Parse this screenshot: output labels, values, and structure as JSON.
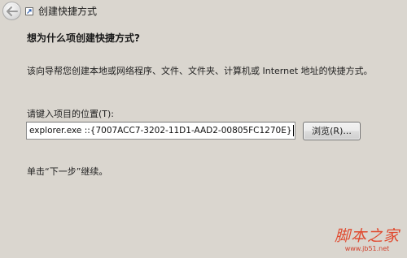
{
  "header": {
    "title": "创建快捷方式",
    "back_icon": "back-arrow-icon",
    "window_icon": "shortcut-icon"
  },
  "main": {
    "heading": "想为什么项创建快捷方式?",
    "description": "该向导帮您创建本地或网络程序、文件、文件夹、计算机或 Internet 地址的快捷方式。",
    "location_label": "请键入项目的位置(T):",
    "location_value": "explorer.exe ::{7007ACC7-3202-11D1-AAD2-00805FC1270E}",
    "browse_label": "浏览(R)...",
    "hint": "单击“下一步”继续。"
  },
  "watermark": {
    "title": "脚本之家",
    "url": "www.jb51.net"
  },
  "colors": {
    "background": "#dad6cf",
    "input_background": "#ffffff",
    "watermark": "#e04a2f"
  }
}
